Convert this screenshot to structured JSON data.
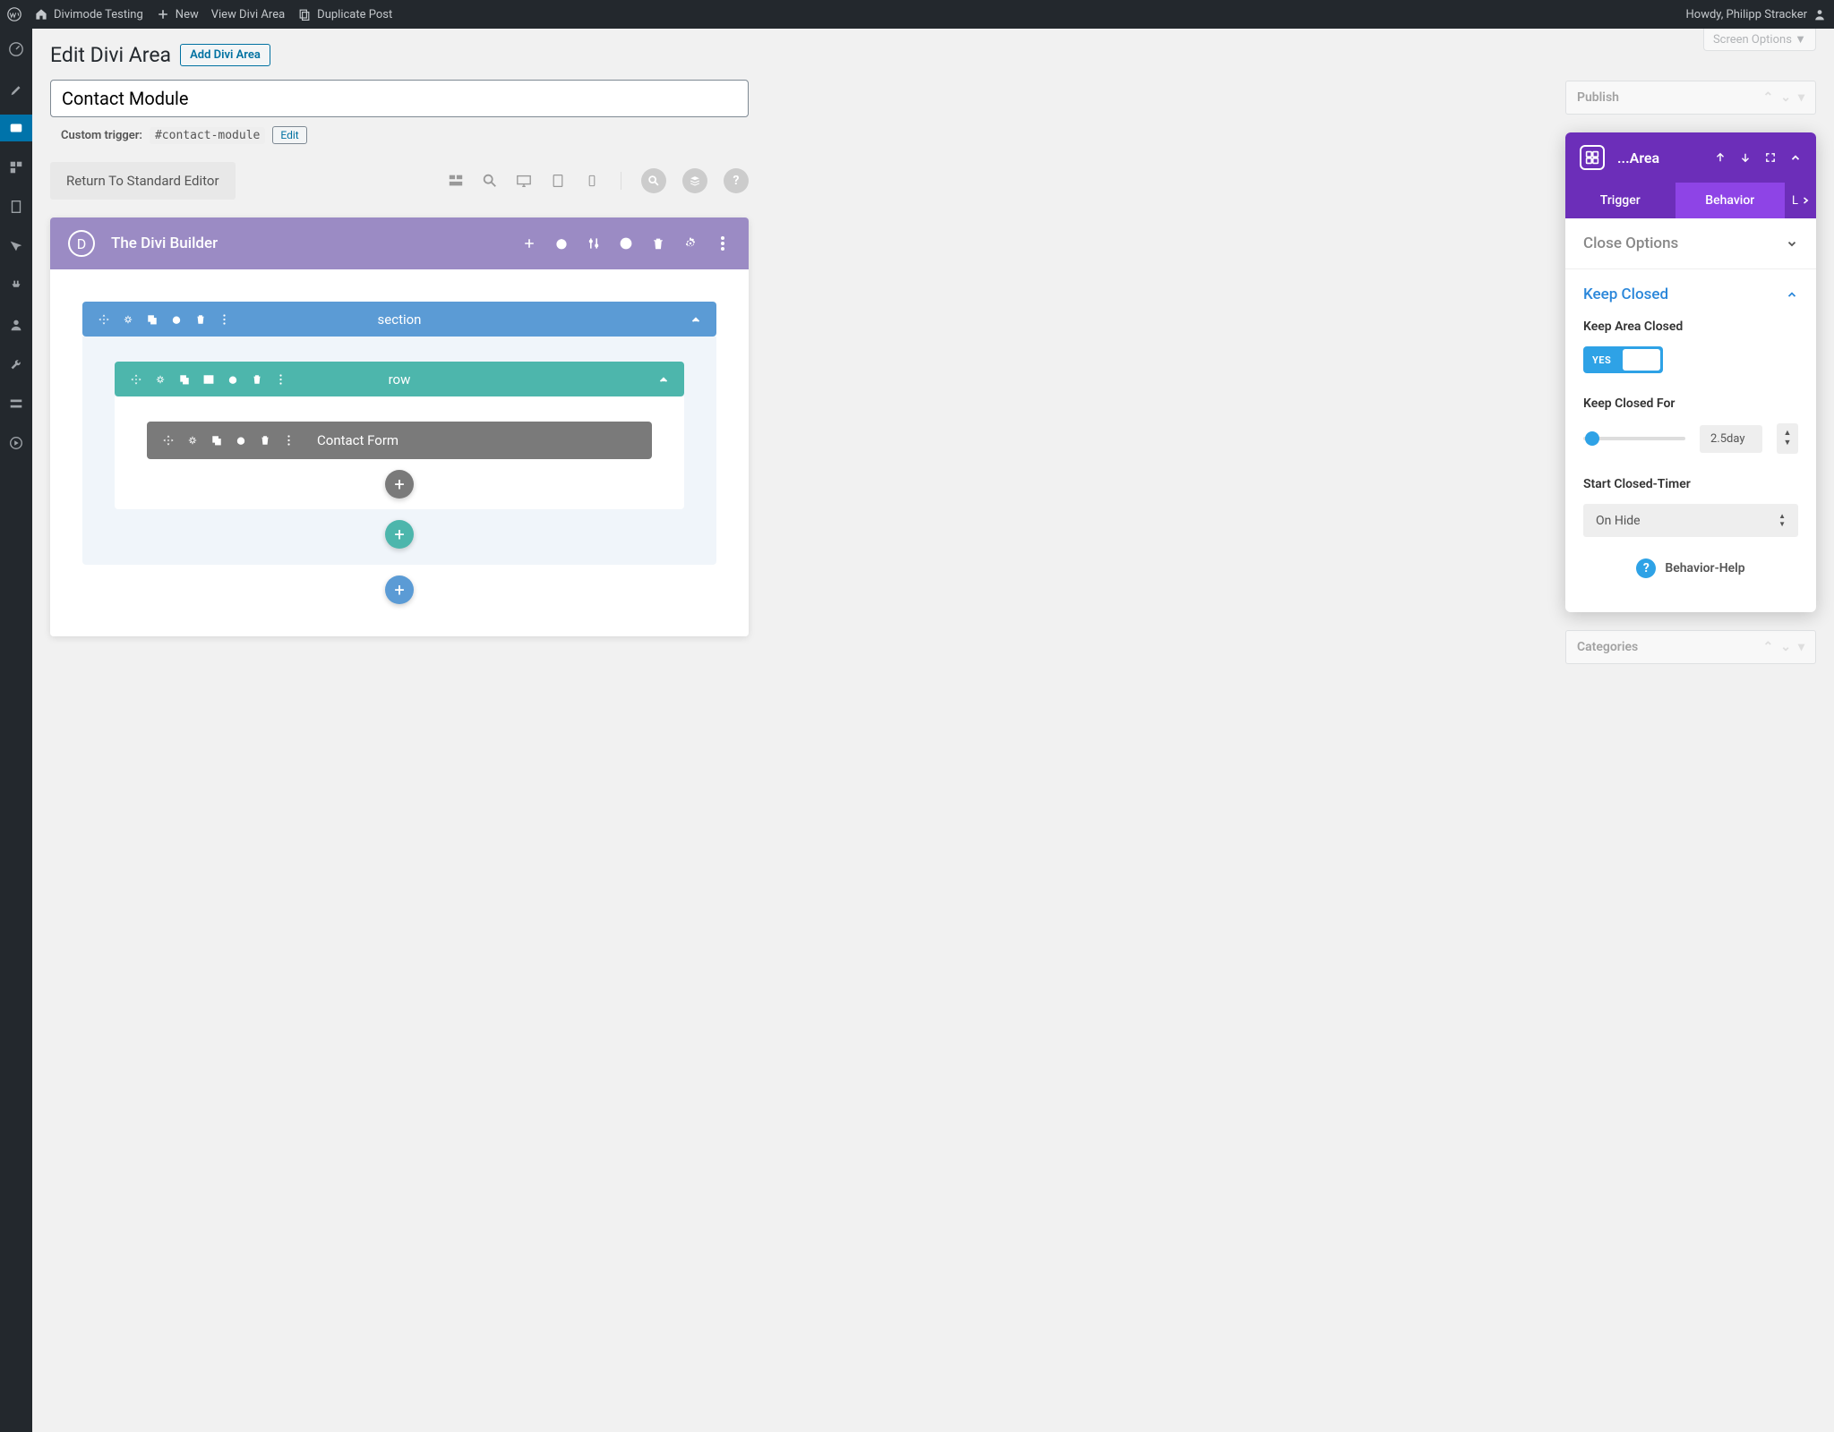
{
  "adminBar": {
    "siteName": "Divimode Testing",
    "new": "New",
    "viewArea": "View Divi Area",
    "duplicate": "Duplicate Post",
    "greeting": "Howdy, Philipp Stracker"
  },
  "screenOptions": "Screen Options ▼",
  "pageHeader": {
    "title": "Edit Divi Area",
    "addNew": "Add Divi Area"
  },
  "post": {
    "title": "Contact Module",
    "triggerLabel": "Custom trigger:",
    "triggerValue": "#contact-module",
    "triggerEdit": "Edit"
  },
  "editor": {
    "returnButton": "Return To Standard Editor"
  },
  "diviBuilder": {
    "title": "The Divi Builder",
    "section": "section",
    "row": "row",
    "module": "Contact Form"
  },
  "sidebar": {
    "publish": "Publish",
    "categories": "Categories"
  },
  "settings": {
    "headerTitle": "...Area",
    "tabs": {
      "trigger": "Trigger",
      "behavior": "Behavior",
      "more": "L"
    },
    "closeOptions": "Close Options",
    "keepClosed": {
      "title": "Keep Closed",
      "label1": "Keep Area Closed",
      "toggleValue": "YES",
      "label2": "Keep Closed For",
      "sliderValue": "2.5day",
      "label3": "Start Closed-Timer",
      "selectValue": "On Hide"
    },
    "help": "Behavior-Help"
  }
}
